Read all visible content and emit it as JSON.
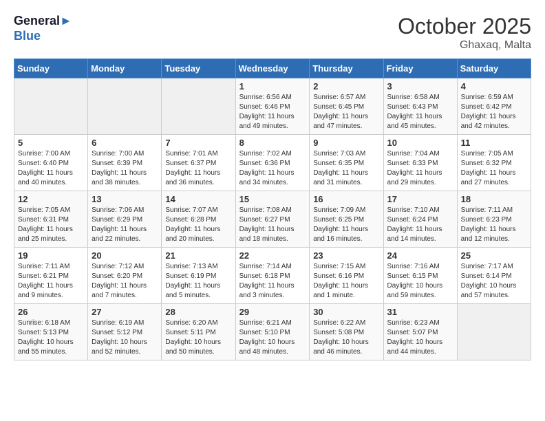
{
  "header": {
    "logo_line1": "General",
    "logo_line2": "Blue",
    "month": "October 2025",
    "location": "Ghaxaq, Malta"
  },
  "weekdays": [
    "Sunday",
    "Monday",
    "Tuesday",
    "Wednesday",
    "Thursday",
    "Friday",
    "Saturday"
  ],
  "weeks": [
    [
      {
        "day": "",
        "info": ""
      },
      {
        "day": "",
        "info": ""
      },
      {
        "day": "",
        "info": ""
      },
      {
        "day": "1",
        "info": "Sunrise: 6:56 AM\nSunset: 6:46 PM\nDaylight: 11 hours\nand 49 minutes."
      },
      {
        "day": "2",
        "info": "Sunrise: 6:57 AM\nSunset: 6:45 PM\nDaylight: 11 hours\nand 47 minutes."
      },
      {
        "day": "3",
        "info": "Sunrise: 6:58 AM\nSunset: 6:43 PM\nDaylight: 11 hours\nand 45 minutes."
      },
      {
        "day": "4",
        "info": "Sunrise: 6:59 AM\nSunset: 6:42 PM\nDaylight: 11 hours\nand 42 minutes."
      }
    ],
    [
      {
        "day": "5",
        "info": "Sunrise: 7:00 AM\nSunset: 6:40 PM\nDaylight: 11 hours\nand 40 minutes."
      },
      {
        "day": "6",
        "info": "Sunrise: 7:00 AM\nSunset: 6:39 PM\nDaylight: 11 hours\nand 38 minutes."
      },
      {
        "day": "7",
        "info": "Sunrise: 7:01 AM\nSunset: 6:37 PM\nDaylight: 11 hours\nand 36 minutes."
      },
      {
        "day": "8",
        "info": "Sunrise: 7:02 AM\nSunset: 6:36 PM\nDaylight: 11 hours\nand 34 minutes."
      },
      {
        "day": "9",
        "info": "Sunrise: 7:03 AM\nSunset: 6:35 PM\nDaylight: 11 hours\nand 31 minutes."
      },
      {
        "day": "10",
        "info": "Sunrise: 7:04 AM\nSunset: 6:33 PM\nDaylight: 11 hours\nand 29 minutes."
      },
      {
        "day": "11",
        "info": "Sunrise: 7:05 AM\nSunset: 6:32 PM\nDaylight: 11 hours\nand 27 minutes."
      }
    ],
    [
      {
        "day": "12",
        "info": "Sunrise: 7:05 AM\nSunset: 6:31 PM\nDaylight: 11 hours\nand 25 minutes."
      },
      {
        "day": "13",
        "info": "Sunrise: 7:06 AM\nSunset: 6:29 PM\nDaylight: 11 hours\nand 22 minutes."
      },
      {
        "day": "14",
        "info": "Sunrise: 7:07 AM\nSunset: 6:28 PM\nDaylight: 11 hours\nand 20 minutes."
      },
      {
        "day": "15",
        "info": "Sunrise: 7:08 AM\nSunset: 6:27 PM\nDaylight: 11 hours\nand 18 minutes."
      },
      {
        "day": "16",
        "info": "Sunrise: 7:09 AM\nSunset: 6:25 PM\nDaylight: 11 hours\nand 16 minutes."
      },
      {
        "day": "17",
        "info": "Sunrise: 7:10 AM\nSunset: 6:24 PM\nDaylight: 11 hours\nand 14 minutes."
      },
      {
        "day": "18",
        "info": "Sunrise: 7:11 AM\nSunset: 6:23 PM\nDaylight: 11 hours\nand 12 minutes."
      }
    ],
    [
      {
        "day": "19",
        "info": "Sunrise: 7:11 AM\nSunset: 6:21 PM\nDaylight: 11 hours\nand 9 minutes."
      },
      {
        "day": "20",
        "info": "Sunrise: 7:12 AM\nSunset: 6:20 PM\nDaylight: 11 hours\nand 7 minutes."
      },
      {
        "day": "21",
        "info": "Sunrise: 7:13 AM\nSunset: 6:19 PM\nDaylight: 11 hours\nand 5 minutes."
      },
      {
        "day": "22",
        "info": "Sunrise: 7:14 AM\nSunset: 6:18 PM\nDaylight: 11 hours\nand 3 minutes."
      },
      {
        "day": "23",
        "info": "Sunrise: 7:15 AM\nSunset: 6:16 PM\nDaylight: 11 hours\nand 1 minute."
      },
      {
        "day": "24",
        "info": "Sunrise: 7:16 AM\nSunset: 6:15 PM\nDaylight: 10 hours\nand 59 minutes."
      },
      {
        "day": "25",
        "info": "Sunrise: 7:17 AM\nSunset: 6:14 PM\nDaylight: 10 hours\nand 57 minutes."
      }
    ],
    [
      {
        "day": "26",
        "info": "Sunrise: 6:18 AM\nSunset: 5:13 PM\nDaylight: 10 hours\nand 55 minutes."
      },
      {
        "day": "27",
        "info": "Sunrise: 6:19 AM\nSunset: 5:12 PM\nDaylight: 10 hours\nand 52 minutes."
      },
      {
        "day": "28",
        "info": "Sunrise: 6:20 AM\nSunset: 5:11 PM\nDaylight: 10 hours\nand 50 minutes."
      },
      {
        "day": "29",
        "info": "Sunrise: 6:21 AM\nSunset: 5:10 PM\nDaylight: 10 hours\nand 48 minutes."
      },
      {
        "day": "30",
        "info": "Sunrise: 6:22 AM\nSunset: 5:08 PM\nDaylight: 10 hours\nand 46 minutes."
      },
      {
        "day": "31",
        "info": "Sunrise: 6:23 AM\nSunset: 5:07 PM\nDaylight: 10 hours\nand 44 minutes."
      },
      {
        "day": "",
        "info": ""
      }
    ]
  ]
}
